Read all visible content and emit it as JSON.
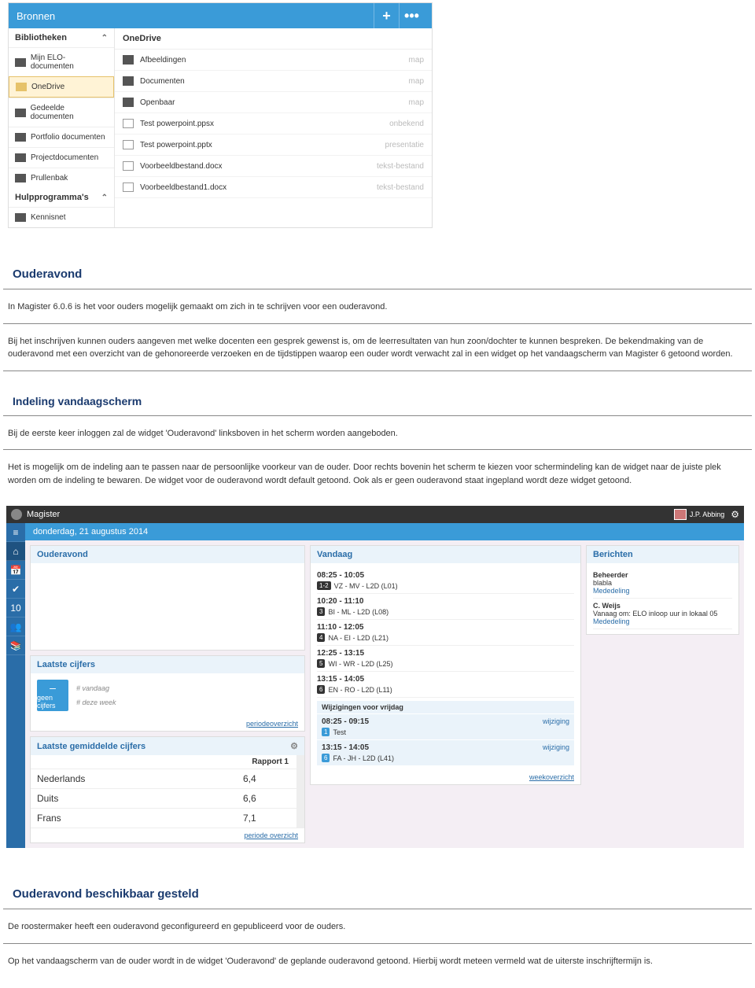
{
  "bronnen": {
    "title": "Bronnen",
    "sidebar": {
      "lib_header": "Bibliotheken",
      "items": [
        {
          "label": "Mijn ELO-documenten"
        },
        {
          "label": "OneDrive",
          "selected": true
        },
        {
          "label": "Gedeelde documenten"
        },
        {
          "label": "Portfolio documenten"
        },
        {
          "label": "Projectdocumenten"
        },
        {
          "label": "Prullenbak"
        }
      ],
      "tools_header": "Hulpprogramma's",
      "tools": [
        {
          "label": "Kennisnet"
        }
      ]
    },
    "content": {
      "header": "OneDrive",
      "rows": [
        {
          "name": "Afbeeldingen",
          "meta": "map",
          "type": "folder"
        },
        {
          "name": "Documenten",
          "meta": "map",
          "type": "folder"
        },
        {
          "name": "Openbaar",
          "meta": "map",
          "type": "folder"
        },
        {
          "name": "Test powerpoint.ppsx",
          "meta": "onbekend",
          "type": "file"
        },
        {
          "name": "Test powerpoint.pptx",
          "meta": "presentatie",
          "type": "pres"
        },
        {
          "name": "Voorbeeldbestand.docx",
          "meta": "tekst-bestand",
          "type": "doc"
        },
        {
          "name": "Voorbeeldbestand1.docx",
          "meta": "tekst-bestand",
          "type": "doc"
        }
      ]
    }
  },
  "doc": {
    "h_ouderavond": "Ouderavond",
    "p1": "In Magister 6.0.6 is het voor ouders mogelijk gemaakt om zich in te schrijven voor een ouderavond.",
    "p2": "Bij het inschrijven kunnen ouders aangeven met welke docenten een gesprek gewenst is, om de leerresultaten van hun zoon/dochter te kunnen bespreken. De bekendmaking van de ouderavond met een overzicht van de gehonoreerde verzoeken en de tijdstippen waarop een ouder wordt verwacht zal in een widget op het vandaagscherm van Magister 6 getoond worden.",
    "h_indeling": "Indeling vandaagscherm",
    "p3": "Bij de eerste keer inloggen zal de widget 'Ouderavond' linksboven in het scherm worden aangeboden.",
    "p4": "Het is mogelijk om de indeling aan te passen naar de persoonlijke voorkeur van de ouder. Door rechts bovenin het scherm te kiezen voor schermindeling kan de widget naar de juiste plek worden om de indeling te bewaren. De widget voor de ouderavond wordt default getoond. Ook als er geen ouderavond staat ingepland wordt deze widget getoond.",
    "h_beschikbaar": "Ouderavond beschikbaar gesteld",
    "p5": "De roostermaker heeft een ouderavond geconfigureerd en gepubliceerd voor de ouders.",
    "p6": "Op het vandaagscherm van de ouder wordt in de widget 'Ouderavond' de geplande ouderavond getoond. Hierbij wordt meteen vermeld wat de uiterste inschrijftermijn is."
  },
  "mag": {
    "appname": "Magister",
    "username": "J.P. Abbing",
    "date": "donderdag, 21 augustus 2014",
    "ouderavond_title": "Ouderavond",
    "cijfers_title": "Laatste cijfers",
    "cijfer_tile_text": "geen cijfers",
    "cijfer_dash": "–",
    "cijfer_info1": "# vandaag",
    "cijfer_info2": "# deze week",
    "cijfers_footer": "periodeoverzicht",
    "gem_title": "Laatste gemiddelde cijfers",
    "gem_head": "Rapport 1",
    "gem_rows": [
      {
        "vak": "Nederlands",
        "cijfer": "6,4"
      },
      {
        "vak": "Duits",
        "cijfer": "6,6"
      },
      {
        "vak": "Frans",
        "cijfer": "7,1"
      }
    ],
    "gem_footer": "periode overzicht",
    "vandaag_title": "Vandaag",
    "vandaag_items": [
      {
        "time": "08:25 - 10:05",
        "slot": "1-2",
        "txt": "VZ - MV - L2D (L01)"
      },
      {
        "time": "10:20 - 11:10",
        "slot": "3",
        "txt": "BI - ML - L2D (L08)"
      },
      {
        "time": "11:10 - 12:05",
        "slot": "4",
        "txt": "NA - EI - L2D (L21)"
      },
      {
        "time": "12:25 - 13:15",
        "slot": "5",
        "txt": "WI - WR - L2D (L25)"
      },
      {
        "time": "13:15 - 14:05",
        "slot": "6",
        "txt": "EN - RO - L2D (L11)"
      }
    ],
    "wijz_head": "Wijzigingen voor vrijdag",
    "wijz_items": [
      {
        "time": "08:25 - 09:15",
        "slot": "1",
        "txt": "Test",
        "tag": "wijziging"
      },
      {
        "time": "13:15 - 14:05",
        "slot": "6",
        "txt": "FA - JH - L2D (L41)",
        "tag": "wijziging"
      }
    ],
    "vandaag_footer": "weekoverzicht",
    "berichten_title": "Berichten",
    "berichten": [
      {
        "from": "Beheerder",
        "sub": "blabla",
        "link": "Mededeling"
      },
      {
        "from": "C. Weijs",
        "sub": "Vanaag om: ELO inloop uur in lokaal 05",
        "link": "Mededeling"
      }
    ]
  }
}
